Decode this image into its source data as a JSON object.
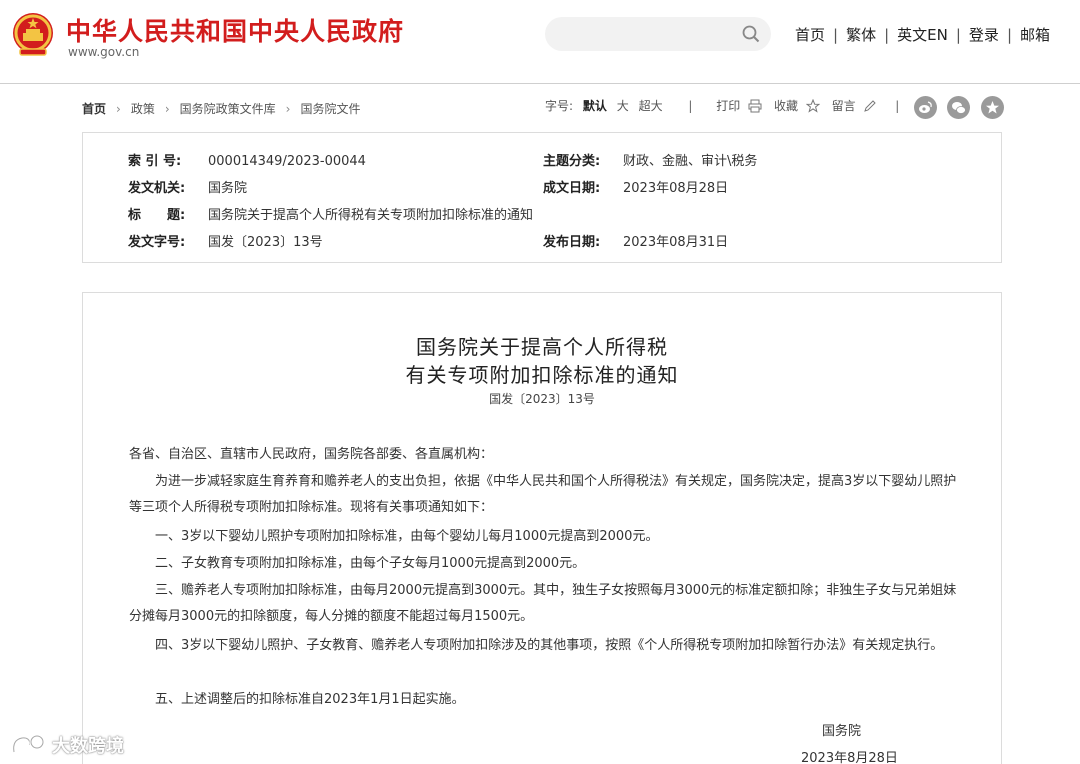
{
  "header": {
    "site_title": "中华人民共和国中央人民政府",
    "site_url": "www.gov.cn",
    "nav": [
      "首页",
      "繁体",
      "英文EN",
      "登录",
      "邮箱"
    ]
  },
  "breadcrumb": [
    "首页",
    "政策",
    "国务院政策文件库",
    "国务院文件"
  ],
  "toolbar": {
    "font_size_label": "字号:",
    "font_default": "默认",
    "font_large": "大",
    "font_xlarge": "超大",
    "print": "打印",
    "favorite": "收藏",
    "comment": "留言"
  },
  "metadata": {
    "index_no_label": "索 引 号:",
    "index_no": "000014349/2023-00044",
    "topic_label": "主题分类:",
    "topic": "财政、金融、审计\\税务",
    "issuer_label": "发文机关:",
    "issuer": "国务院",
    "written_label": "成文日期:",
    "written_date": "2023年08月28日",
    "title_label": "标　　题:",
    "title": "国务院关于提高个人所得税有关专项附加扣除标准的通知",
    "doc_no_label": "发文字号:",
    "doc_no": "国发〔2023〕13号",
    "published_label": "发布日期:",
    "published_date": "2023年08月31日"
  },
  "article": {
    "title_line1": "国务院关于提高个人所得税",
    "title_line2": "有关专项附加扣除标准的通知",
    "doc_no": "国发〔2023〕13号",
    "salutation": "各省、自治区、直辖市人民政府，国务院各部委、各直属机构：",
    "intro": "为进一步减轻家庭生育养育和赡养老人的支出负担，依据《中华人民共和国个人所得税法》有关规定，国务院决定，提高3岁以下婴幼儿照护等三项个人所得税专项附加扣除标准。现将有关事项通知如下：",
    "item1": "一、3岁以下婴幼儿照护专项附加扣除标准，由每个婴幼儿每月1000元提高到2000元。",
    "item2": "二、子女教育专项附加扣除标准，由每个子女每月1000元提高到2000元。",
    "item3": "三、赡养老人专项附加扣除标准，由每月2000元提高到3000元。其中，独生子女按照每月3000元的标准定额扣除；非独生子女与兄弟姐妹分摊每月3000元的扣除额度，每人分摊的额度不能超过每月1500元。",
    "item4": "四、3岁以下婴幼儿照护、子女教育、赡养老人专项附加扣除涉及的其他事项，按照《个人所得税专项附加扣除暂行办法》有关规定执行。",
    "item5": "五、上述调整后的扣除标准自2023年1月1日起实施。",
    "signature": "国务院",
    "sign_date": "2023年8月28日"
  },
  "watermark": "大数跨境",
  "colors": {
    "brand_red": "#d21d1d",
    "icon_gray": "#9a9a9a",
    "border": "#dcdcdc"
  }
}
